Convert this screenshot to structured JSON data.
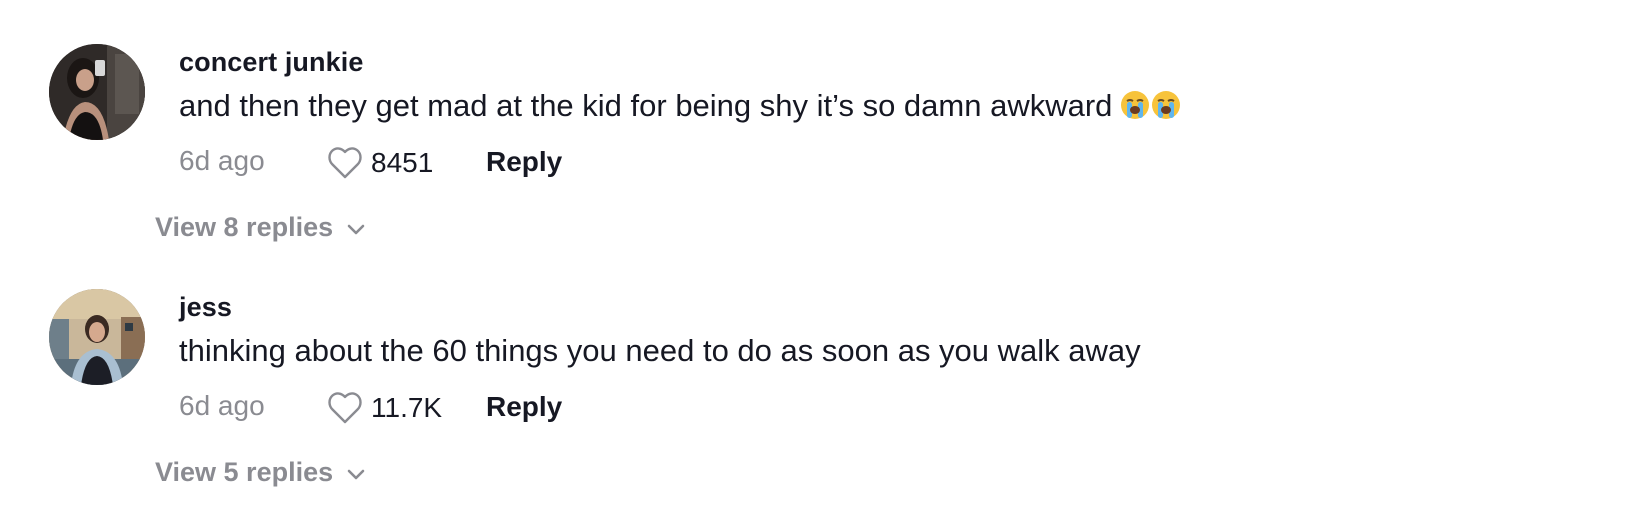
{
  "comments": [
    {
      "username": "concert junkie",
      "text": "and then they get mad at the kid for being shy it’s so damn awkward",
      "emoji": [
        "loudly-crying-face",
        "loudly-crying-face"
      ],
      "time": "6d ago",
      "likes": "8451",
      "reply_label": "Reply",
      "view_replies": "View 8 replies"
    },
    {
      "username": "jess",
      "text": "thinking about the 60 things you need to do as soon as you walk away",
      "emoji": [],
      "time": "6d ago",
      "likes": "11.7K",
      "reply_label": "Reply",
      "view_replies": "View 5 replies"
    }
  ],
  "icons": {
    "like": "heart-outline-icon",
    "expand": "chevron-down-icon"
  },
  "colors": {
    "primary_text": "#161823",
    "secondary_text": "#8a8b91",
    "background": "#ffffff"
  }
}
